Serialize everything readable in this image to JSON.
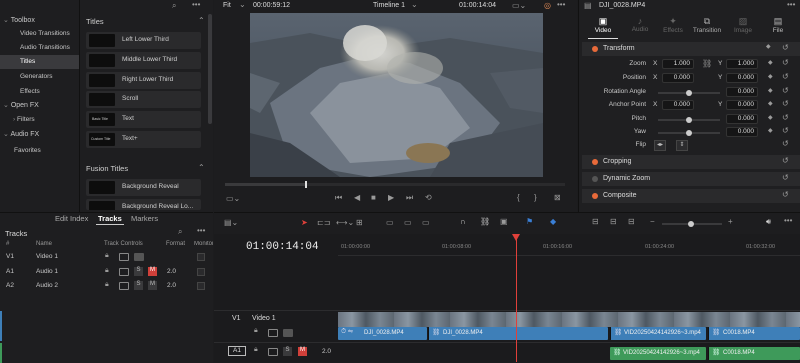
{
  "sidebar": {
    "items": [
      {
        "label": "Toolbox",
        "expanded": true
      },
      {
        "label": "Video Transitions"
      },
      {
        "label": "Audio Transitions"
      },
      {
        "label": "Titles",
        "selected": true
      },
      {
        "label": "Generators"
      },
      {
        "label": "Effects"
      },
      {
        "label": "Open FX",
        "expanded": true
      },
      {
        "label": "Filters"
      },
      {
        "label": "Audio FX",
        "expanded": true
      },
      {
        "label": "Favorites"
      }
    ]
  },
  "titles": {
    "header": "Titles",
    "items": [
      "Left Lower Third",
      "Middle Lower Third",
      "Right Lower Third",
      "Scroll",
      "Text",
      "Text+"
    ],
    "thumbs": [
      "",
      "",
      "",
      "",
      "Basic Title",
      "Custom Title"
    ],
    "fusion_header": "Fusion Titles",
    "fusion_items": [
      "Background Reveal",
      "Background Reveal Lo..."
    ]
  },
  "viewer": {
    "zoom": "Fit",
    "timecode_left": "00:00:59:12",
    "timeline_name": "Timeline 1",
    "timecode_right": "01:00:14:04"
  },
  "inspector": {
    "clip_name": "DJI_0028.MP4",
    "tabs": [
      "Video",
      "Audio",
      "Effects",
      "Transition",
      "Image",
      "File"
    ],
    "transform_label": "Transform",
    "zoom": {
      "label": "Zoom",
      "x": "1.000",
      "y": "1.000"
    },
    "position": {
      "label": "Position",
      "x": "0.000",
      "y": "0.000"
    },
    "rotation": {
      "label": "Rotation Angle",
      "value": "0.000"
    },
    "anchor": {
      "label": "Anchor Point",
      "x": "0.000",
      "y": "0.000"
    },
    "pitch": {
      "label": "Pitch",
      "value": "0.000"
    },
    "yaw": {
      "label": "Yaw",
      "value": "0.000"
    },
    "flip": {
      "label": "Flip"
    },
    "x_axis": "X",
    "y_axis": "Y",
    "sections": [
      "Cropping",
      "Dynamic Zoom",
      "Composite"
    ]
  },
  "tracks_panel": {
    "tabs": [
      "Edit Index",
      "Tracks",
      "Markers"
    ],
    "title": "Tracks",
    "columns": [
      "#",
      "Name",
      "Track Controls",
      "Format",
      "Monitor"
    ],
    "rows": [
      {
        "id": "V1",
        "name": "Video 1",
        "format": ""
      },
      {
        "id": "A1",
        "name": "Audio 1",
        "format": "2.0"
      },
      {
        "id": "A2",
        "name": "Audio 2",
        "format": "2.0"
      }
    ],
    "solo": "S",
    "mute": "M"
  },
  "timeline": {
    "timecode": "01:00:14:04",
    "ruler": [
      "01:00:00:00",
      "01:00:08:00",
      "01:00:16:00",
      "01:00:24:00",
      "01:00:32:00"
    ],
    "v1": {
      "id": "V1",
      "name": "Video 1"
    },
    "a1": {
      "id": "A1",
      "format": "2.0"
    },
    "clips": [
      "DJI_0028.MP4",
      "DJI_0028.MP4",
      "VID20250424142926~3.mp4",
      "C0018.MP4"
    ],
    "audio_clips": [
      "VID20250424142926~3.mp4",
      "C0018.MP4"
    ],
    "playhead_color": "#e0403a",
    "video_clip_color": "#3e7fb8",
    "audio_clip_color": "#3e9a5a"
  }
}
